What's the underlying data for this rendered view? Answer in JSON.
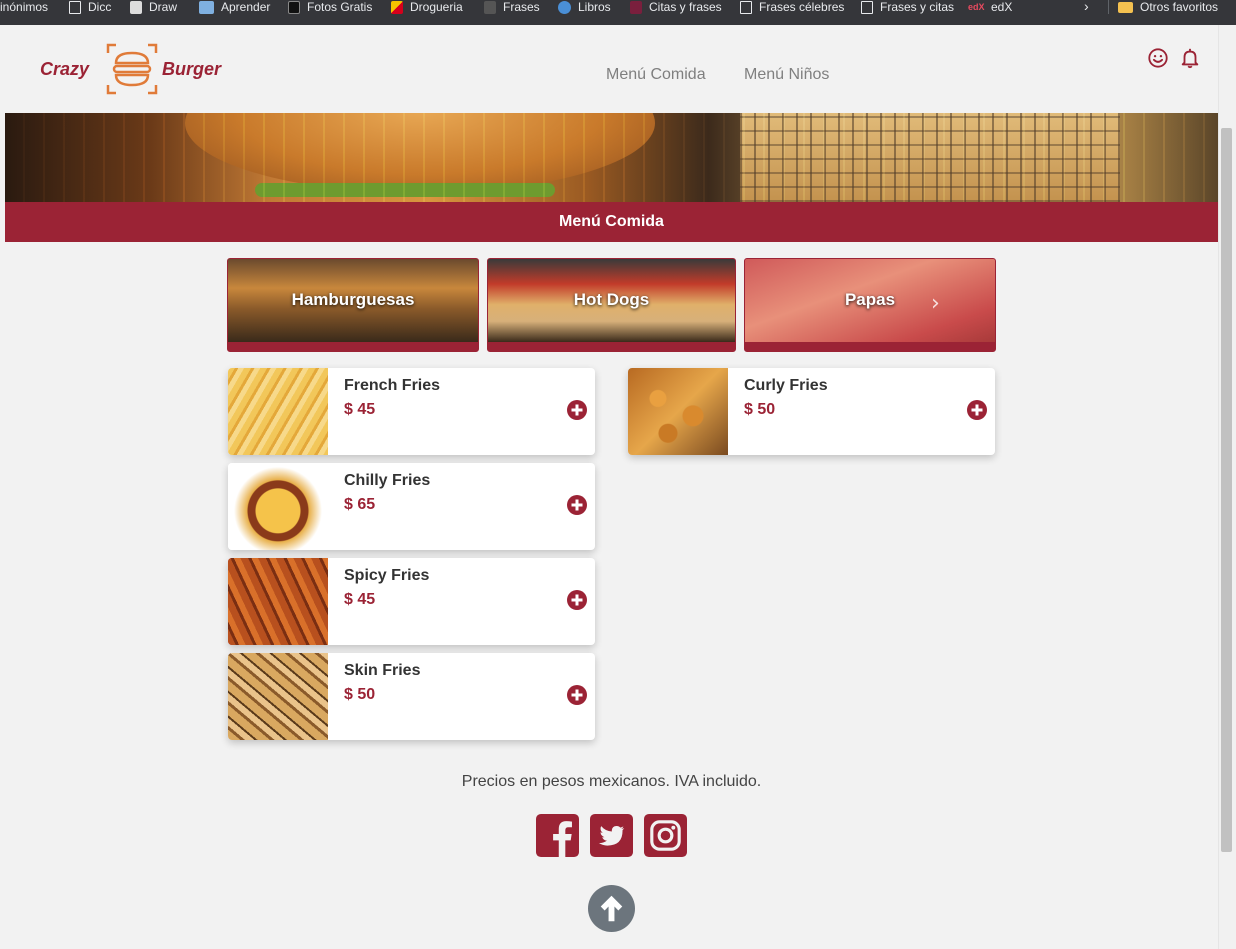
{
  "bookmarks": {
    "items": [
      {
        "label": "Sinónimos"
      },
      {
        "label": "Dicc"
      },
      {
        "label": "Draw"
      },
      {
        "label": "Aprender"
      },
      {
        "label": "Fotos Gratis"
      },
      {
        "label": "Drogueria"
      },
      {
        "label": "Frases"
      },
      {
        "label": "Libros"
      },
      {
        "label": "Citas y frases"
      },
      {
        "label": "Frases célebres"
      },
      {
        "label": "Frases y citas"
      },
      {
        "label": "edX"
      }
    ],
    "other_favorites": "Otros favoritos"
  },
  "header": {
    "logo_left": "Crazy",
    "logo_right": "Burger",
    "nav": [
      "Menú Comida",
      "Menú Niños"
    ],
    "icons": [
      "smile-icon",
      "bell-icon"
    ]
  },
  "band": {
    "title": "Menú Comida"
  },
  "categories": [
    {
      "label": "Hamburguesas"
    },
    {
      "label": "Hot Dogs"
    },
    {
      "label": "Papas"
    }
  ],
  "products": [
    {
      "name": "French Fries",
      "price": "$ 45"
    },
    {
      "name": "Curly Fries",
      "price": "$ 50"
    },
    {
      "name": "Chilly Fries",
      "price": "$ 65"
    },
    {
      "name": "Spicy Fries",
      "price": "$ 45"
    },
    {
      "name": "Skin Fries",
      "price": "$ 50"
    }
  ],
  "footer": {
    "note": "Precios en pesos mexicanos. IVA incluido.",
    "social": [
      "facebook-icon",
      "twitter-icon",
      "instagram-icon"
    ]
  },
  "colors": {
    "brand": "#9b2335",
    "accent": "#e07b39",
    "background": "#f2f2f2"
  }
}
